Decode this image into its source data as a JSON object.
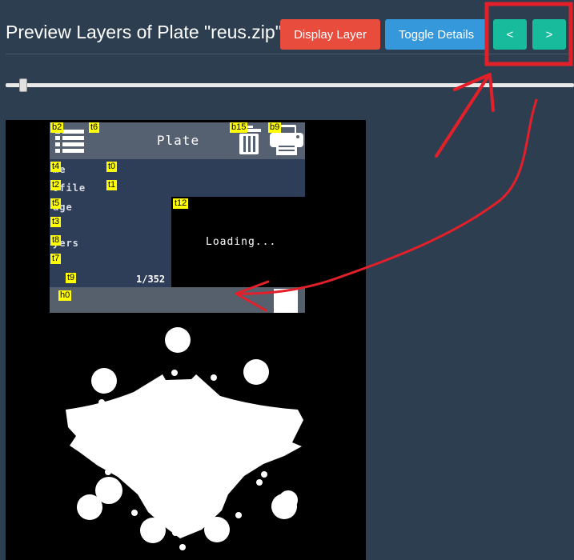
{
  "header": {
    "title": "Preview Layers of Plate \"reus.zip\"",
    "display_layer_label": "Display Layer",
    "toggle_details_label": "Toggle Details",
    "prev_label": "<",
    "next_label": ">"
  },
  "slider": {
    "value_fraction": 0.03
  },
  "device": {
    "title": "Plate",
    "fields": [
      "me",
      "ofile",
      "age",
      "yers"
    ],
    "loading_text": "Loading...",
    "counter_text": "1/352",
    "tags": [
      "b2",
      "t6",
      "b15",
      "b9",
      "t4",
      "t0",
      "t2",
      "t1",
      "t5",
      "t12",
      "t3",
      "t8",
      "t7",
      "t9",
      "h0"
    ]
  },
  "colors": {
    "background": "#2c3e50",
    "display_layer": "#e74c3c",
    "toggle_details": "#3498db",
    "nav_buttons": "#18bc9c",
    "annotation": "#e3202a"
  },
  "icons": [
    "menu-icon",
    "trash-icon",
    "printer-icon"
  ]
}
